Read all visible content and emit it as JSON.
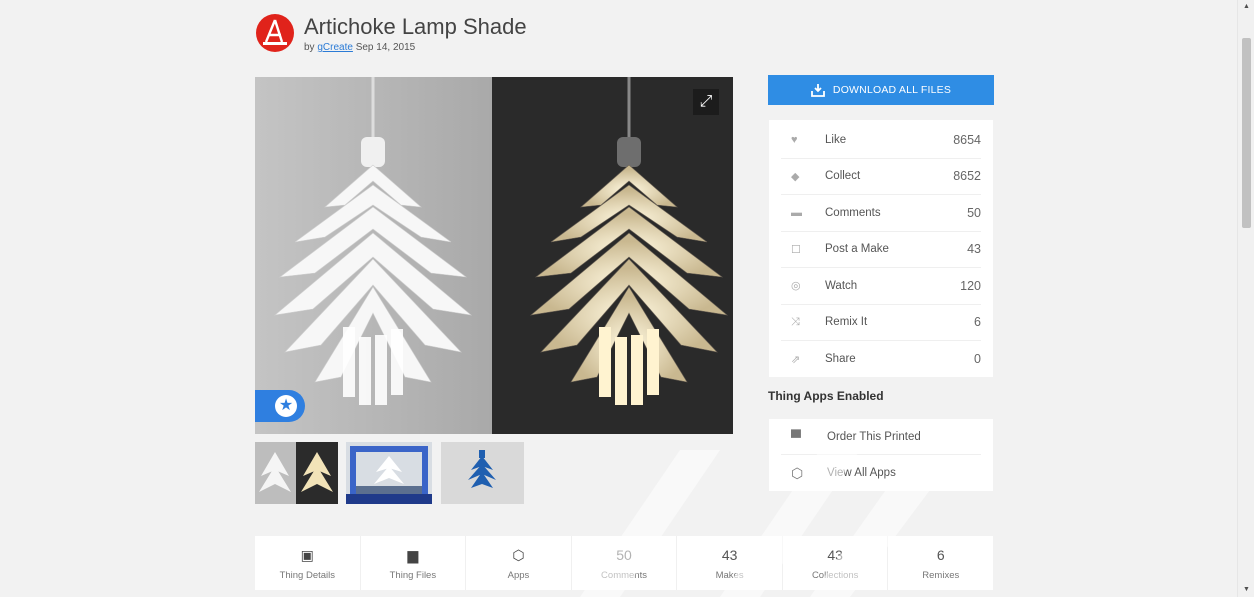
{
  "header": {
    "title": "Artichoke Lamp Shade",
    "by_prefix": "by",
    "author": "gCreate",
    "date": "Sep 14, 2015"
  },
  "gallery": {
    "expand_icon": "expand-icon",
    "featured_icon": "star-icon",
    "thumbnails": [
      "thumbnail-1",
      "thumbnail-2",
      "thumbnail-3"
    ]
  },
  "download": {
    "label": "DOWNLOAD ALL FILES",
    "icon": "download-icon"
  },
  "stats": [
    {
      "icon": "heart-icon",
      "label": "Like",
      "value": "8654"
    },
    {
      "icon": "collect-icon",
      "label": "Collect",
      "value": "8652"
    },
    {
      "icon": "comment-icon",
      "label": "Comments",
      "value": "50"
    },
    {
      "icon": "post-make-icon",
      "label": "Post a Make",
      "value": "43"
    },
    {
      "icon": "eye-icon",
      "label": "Watch",
      "value": "120"
    },
    {
      "icon": "shuffle-icon",
      "label": "Remix It",
      "value": "6"
    },
    {
      "icon": "share-icon",
      "label": "Share",
      "value": "0"
    }
  ],
  "apps": {
    "heading": "Thing Apps Enabled",
    "items": [
      {
        "icon": "printer-icon",
        "label": "Order This Printed"
      },
      {
        "icon": "cube-icon",
        "label": "View All Apps"
      }
    ]
  },
  "tabs": [
    {
      "top": "",
      "icon": "book-icon",
      "label": "Thing Details"
    },
    {
      "top": "",
      "icon": "folder-icon",
      "label": "Thing Files"
    },
    {
      "top": "",
      "icon": "cube-icon",
      "label": "Apps"
    },
    {
      "top": "50",
      "icon": "",
      "label": "Comments"
    },
    {
      "top": "43",
      "icon": "",
      "label": "Makes"
    },
    {
      "top": "43",
      "icon": "",
      "label": "Collections"
    },
    {
      "top": "6",
      "icon": "",
      "label": "Remixes"
    }
  ],
  "colors": {
    "accent": "#2f8de4",
    "avatar": "#e0231b",
    "background": "#f2f2f2"
  }
}
